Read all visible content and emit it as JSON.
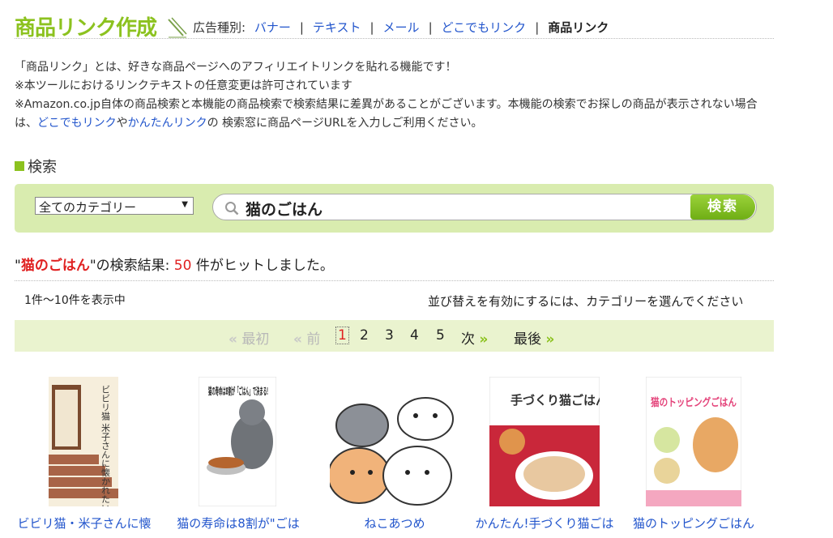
{
  "header": {
    "title": "商品リンク作成",
    "ad_type_label": "広告種別:",
    "ad_types": [
      "バナー",
      "テキスト",
      "メール",
      "どこでもリンク"
    ],
    "current_ad_type": "商品リンク"
  },
  "intro": {
    "line1": "「商品リンク」とは、好きな商品ページへのアフィリエイトリンクを貼れる機能です！",
    "line2": "※本ツールにおけるリンクテキストの任意変更は許可されています",
    "line3": "※Amazon.co.jp自体の商品検索と本機能の商品検索で検索結果に差異があることがございます。本機能の検索でお探しの商品が表示されない場合は、",
    "link1": "どこでもリンク",
    "mid": "や",
    "link2": "かんたんリンク",
    "tail": "の 検索窓に商品ページURLを入力しご利用ください。"
  },
  "search": {
    "section_title": "検索",
    "category": "全てのカテゴリー",
    "query": "猫のごはん",
    "button_label": "検索"
  },
  "results": {
    "quote_open": "\"",
    "keyword": "猫のごはん",
    "quote_close": "\"の検索結果: ",
    "count": "50",
    "suffix": " 件がヒットしました。",
    "range": "1件〜10件を表示中",
    "sort_note": "並び替えを有効にするには、カテゴリーを選んでください"
  },
  "pager": {
    "first": "最初",
    "prev": "前",
    "pages": [
      "1",
      "2",
      "3",
      "4",
      "5"
    ],
    "current": "1",
    "next": "次",
    "last": "最後",
    "arrow_left": "«",
    "arrow_right": "»"
  },
  "products": [
    {
      "title": "ビビリ猫・米子さんに懐",
      "cover_text": "ビビリ猫 米子さんに懐かれたい。"
    },
    {
      "title": "猫の寿命は8割が\"ごは",
      "cover_text": "猫の寿命は8割が「ごはん」で決まる!"
    },
    {
      "title": "ねこあつめ",
      "cover_text": ""
    },
    {
      "title": "かんたん!手づくり猫ごは",
      "cover_text": "手づくり猫ごはん"
    },
    {
      "title": "猫のトッピングごはん",
      "cover_text": "猫のトッピングごはん"
    }
  ],
  "colors": {
    "accent_green": "#8cc21f",
    "panel_green": "#d9ecaf",
    "link_blue": "#2255cc",
    "highlight_red": "#e02020"
  }
}
